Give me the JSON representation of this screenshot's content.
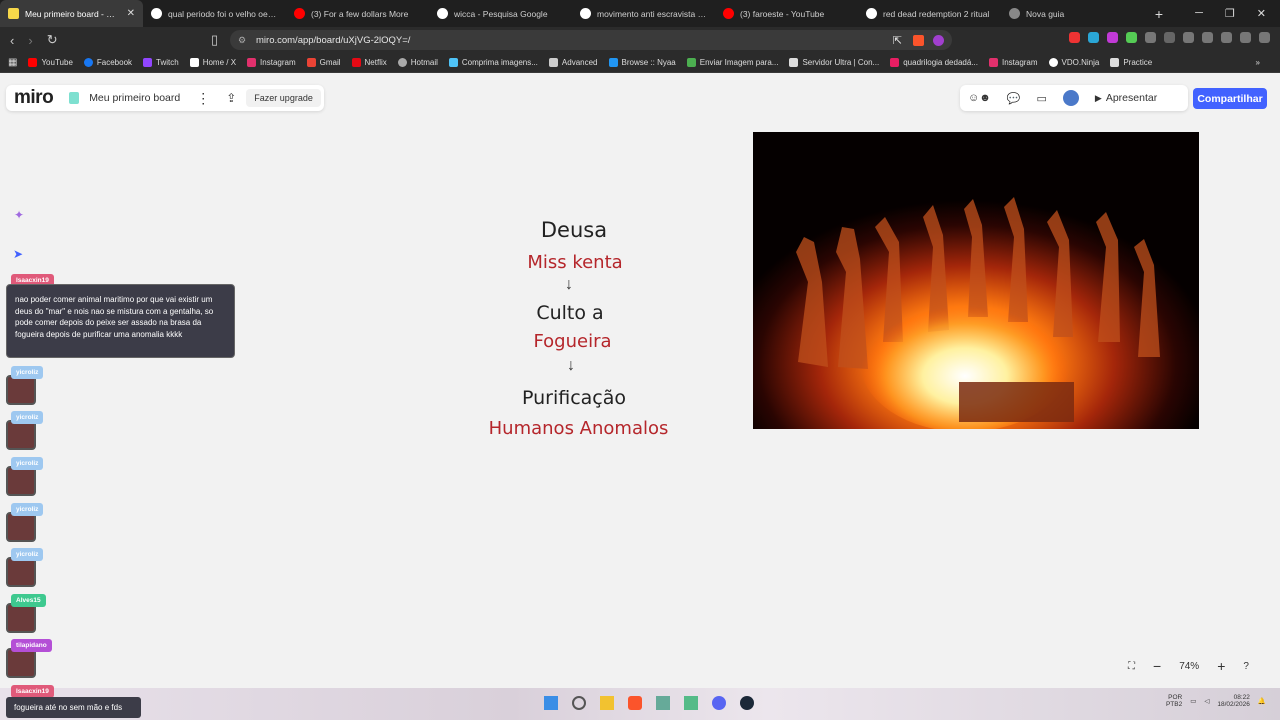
{
  "tabs": [
    {
      "title": "Meu primeiro board - Miro",
      "active": true,
      "color": "#f7d84a"
    },
    {
      "title": "qual periodo foi o velho oeste",
      "color": "#ffffff"
    },
    {
      "title": "(3) For a few dollars More",
      "color": "#ff0000"
    },
    {
      "title": "wicca - Pesquisa Google",
      "color": "#ffffff"
    },
    {
      "title": "movimento anti escravista - Pe",
      "color": "#ffffff"
    },
    {
      "title": "(3) faroeste - YouTube",
      "color": "#ff0000"
    },
    {
      "title": "red dead redemption 2 ritual",
      "color": "#ffffff"
    },
    {
      "title": "Nova guia",
      "color": "#888888"
    }
  ],
  "address": {
    "url": "miro.com/app/board/uXjVG-2lOQY=/"
  },
  "bookmarks": [
    {
      "label": "YouTube",
      "color": "#ff0000"
    },
    {
      "label": "Facebook",
      "color": "#1877f2"
    },
    {
      "label": "Twitch",
      "color": "#9146ff"
    },
    {
      "label": "Home / X",
      "color": "#ffffff"
    },
    {
      "label": "Instagram",
      "color": "#e1306c"
    },
    {
      "label": "Gmail",
      "color": "#ea4335"
    },
    {
      "label": "Netflix",
      "color": "#e50914"
    },
    {
      "label": "Hotmail",
      "color": "#aaaaaa"
    },
    {
      "label": "Comprima imagens...",
      "color": "#4fc3f7"
    },
    {
      "label": "Advanced",
      "color": "#cccccc"
    },
    {
      "label": "Browse :: Nyaa",
      "color": "#2196f3"
    },
    {
      "label": "Enviar Imagem para...",
      "color": "#4caf50"
    },
    {
      "label": "Servidor Ultra | Con...",
      "color": "#dddddd"
    },
    {
      "label": "quadrilogia dedadá...",
      "color": "#e91e63"
    },
    {
      "label": "Instagram",
      "color": "#e1306c"
    },
    {
      "label": "VDO.Ninja",
      "color": "#ffffff"
    },
    {
      "label": "Practice",
      "color": "#dddddd"
    }
  ],
  "miro": {
    "logo": "miro",
    "board_title": "Meu primeiro board",
    "upgrade_label": "Fazer upgrade",
    "present_label": "Apresentar",
    "share_label": "Compartilhar",
    "zoom": "74%",
    "brand_color": "#4262ff"
  },
  "flow": {
    "deusa": "Deusa",
    "miss_kenta": "Miss kenta",
    "culto_a": "Culto a",
    "fogueira": "Fogueira",
    "purificacao": "Purificação",
    "humanos": "Humanos Anomalos"
  },
  "chat": {
    "usernames": [
      "Isaacxin19",
      "yicroliz",
      "yicroliz",
      "yicroliz",
      "yicroliz",
      "yicroliz",
      "Alves15",
      "tilapidano",
      "Isaacxin19"
    ],
    "message": "nao poder comer animal maritimo por que vai existir um deus do \"mar\" e nois nao se mistura com a gentalha, so pode comer depois do peixe ser assado na brasa da fogueira depois de purificar uma anomalia kkkk",
    "bottom_message": "fogueira até no sem mão e fds"
  },
  "system": {
    "lang": "POR",
    "lang2": "PTB2",
    "time": "08:22",
    "date": "18/02/2026"
  }
}
